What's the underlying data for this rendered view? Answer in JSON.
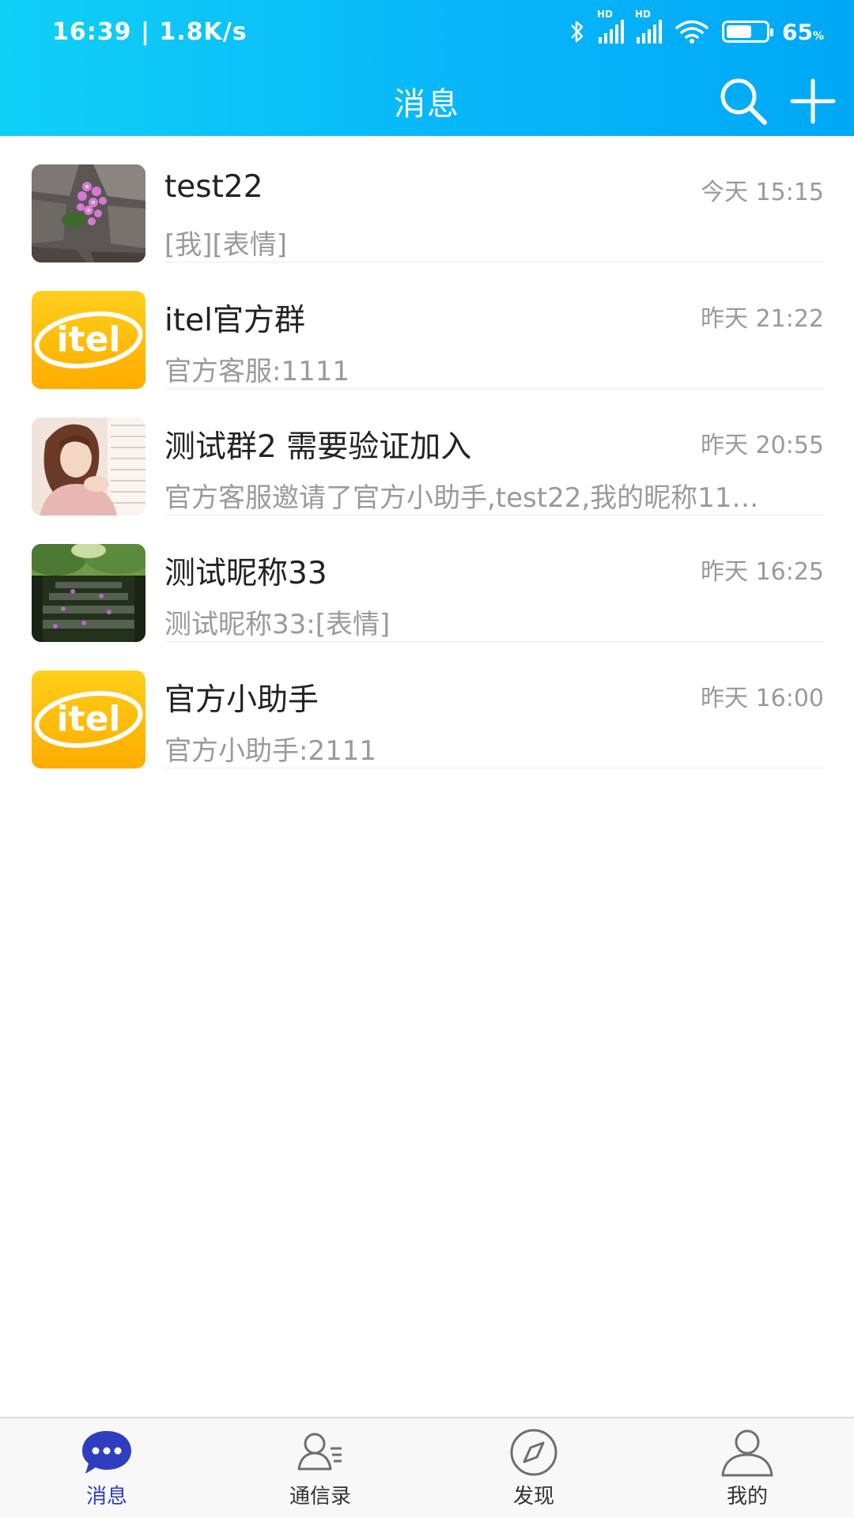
{
  "status_bar": {
    "time_speed": "16:39 | 1.8K/s",
    "battery": "65",
    "battery_unit": "%",
    "hd_label": "HD"
  },
  "header": {
    "title": "消息",
    "search_icon": "search-icon",
    "add_icon": "plus-icon"
  },
  "conversations": [
    {
      "name": "test22",
      "time": "今天 15:15",
      "preview": "[我][表情]",
      "avatar": "flower-rock-photo"
    },
    {
      "name": "itel官方群",
      "time": "昨天 21:22",
      "preview": "官方客服:1111",
      "avatar": "itel-logo",
      "logo_text": "itel"
    },
    {
      "name": "测试群2 需要验证加入",
      "time": "昨天 20:55",
      "preview": "官方客服邀请了官方小助手,test22,我的昵称11…",
      "avatar": "woman-portrait-photo"
    },
    {
      "name": "测试昵称33",
      "time": "昨天 16:25",
      "preview": "测试昵称33:[表情]",
      "avatar": "stone-steps-photo"
    },
    {
      "name": "官方小助手",
      "time": "昨天 16:00",
      "preview": "官方小助手:2111",
      "avatar": "itel-logo",
      "logo_text": "itel"
    }
  ],
  "tabs": [
    {
      "label": "消息",
      "icon": "chat-bubble-icon",
      "active": true
    },
    {
      "label": "通信录",
      "icon": "contacts-icon",
      "active": false
    },
    {
      "label": "发现",
      "icon": "compass-icon",
      "active": false
    },
    {
      "label": "我的",
      "icon": "person-icon",
      "active": false
    }
  ],
  "colors": {
    "header_start": "#10d0f6",
    "header_end": "#00a8f6",
    "active_tab": "#2f3ec0",
    "itel_yellow": "#ffc107"
  }
}
